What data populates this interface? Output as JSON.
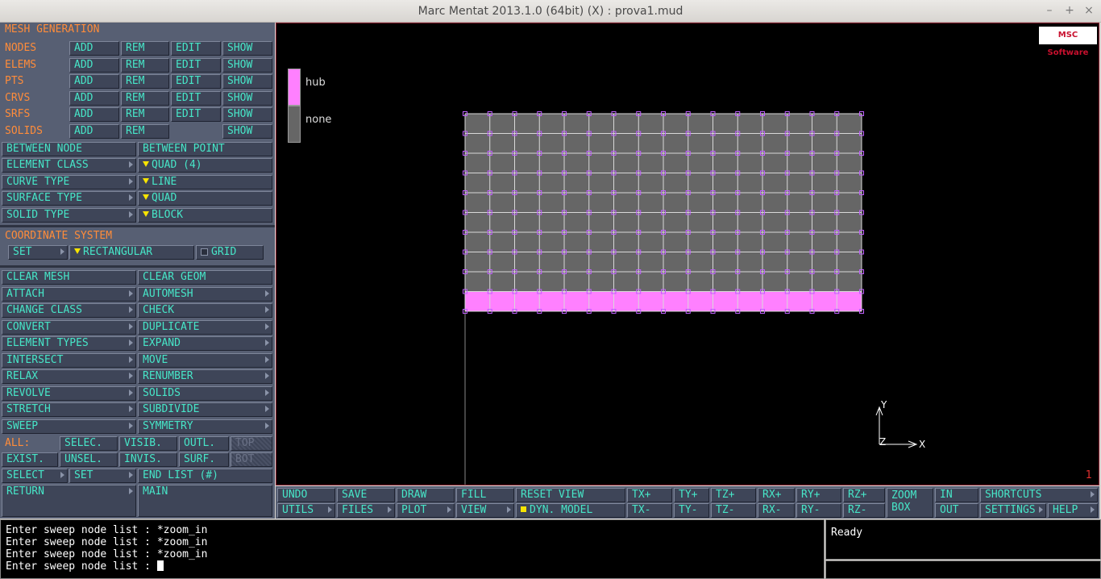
{
  "window": {
    "title": "Marc Mentat 2013.1.0 (64bit) (X) : prova1.mud",
    "controls": [
      "–",
      "+",
      "×"
    ]
  },
  "left_panel": {
    "header": "MESH GENERATION",
    "entity_rows": [
      {
        "label": "NODES",
        "buttons": [
          "ADD",
          "REM",
          "EDIT",
          "SHOW"
        ]
      },
      {
        "label": "ELEMS",
        "buttons": [
          "ADD",
          "REM",
          "EDIT",
          "SHOW"
        ]
      },
      {
        "label": "PTS",
        "buttons": [
          "ADD",
          "REM",
          "EDIT",
          "SHOW"
        ]
      },
      {
        "label": "CRVS",
        "buttons": [
          "ADD",
          "REM",
          "EDIT",
          "SHOW"
        ]
      },
      {
        "label": "SRFS",
        "buttons": [
          "ADD",
          "REM",
          "EDIT",
          "SHOW"
        ]
      },
      {
        "label": "SOLIDS",
        "buttons": [
          "ADD",
          "REM",
          "",
          "SHOW"
        ]
      }
    ],
    "between_node": "BETWEEN NODE",
    "between_point": "BETWEEN POINT",
    "type_rows": [
      {
        "label": "ELEMENT CLASS",
        "value": "QUAD (4)"
      },
      {
        "label": "CURVE TYPE",
        "value": "LINE"
      },
      {
        "label": "SURFACE TYPE",
        "value": "QUAD"
      },
      {
        "label": "SOLID TYPE",
        "value": "BLOCK"
      }
    ],
    "coord_header": "COORDINATE SYSTEM",
    "coord_set": "SET",
    "coord_value": "RECTANGULAR",
    "coord_grid": "GRID",
    "ops": [
      [
        "CLEAR MESH",
        "CLEAR GEOM"
      ],
      [
        "ATTACH",
        "AUTOMESH"
      ],
      [
        "CHANGE CLASS",
        "CHECK"
      ],
      [
        "CONVERT",
        "DUPLICATE"
      ],
      [
        "ELEMENT TYPES",
        "EXPAND"
      ],
      [
        "INTERSECT",
        "MOVE"
      ],
      [
        "RELAX",
        "RENUMBER"
      ],
      [
        "REVOLVE",
        "SOLIDS"
      ],
      [
        "STRETCH",
        "SUBDIVIDE"
      ],
      [
        "SWEEP",
        "SYMMETRY"
      ]
    ],
    "all_label": "ALL:",
    "sel_row1": [
      "SELEC.",
      "VISIB.",
      "OUTL.",
      "TOP"
    ],
    "sel_row2": [
      "EXIST.",
      "UNSEL.",
      "INVIS.",
      "SURF.",
      "BOT"
    ],
    "select": "SELECT",
    "set": "SET",
    "end_list": "END LIST (#)",
    "return": "RETURN",
    "main": "MAIN"
  },
  "viewport": {
    "logo": "MSC Software",
    "legend": [
      {
        "label": "hub",
        "color": "#ff80ff"
      },
      {
        "label": "none",
        "color": "#666666"
      }
    ],
    "axis_x": "X",
    "axis_y": "Y",
    "axis_z": "Z",
    "page_number": "1",
    "mesh": {
      "columns": 16,
      "rows": 10,
      "highlighted_rows": 1,
      "element_color": "#666666",
      "highlight_color": "#ff80ff",
      "node_color": "#c060ff"
    }
  },
  "toolbar": {
    "undo": "UNDO",
    "save": "SAVE",
    "draw": "DRAW",
    "fill": "FILL",
    "reset_view": "RESET VIEW",
    "utils": "UTILS",
    "files": "FILES",
    "plot": "PLOT",
    "view": "VIEW",
    "dyn_model": "DYN. MODEL",
    "tx_plus": "TX+",
    "ty_plus": "TY+",
    "tz_plus": "TZ+",
    "rx_plus": "RX+",
    "ry_plus": "RY+",
    "rz_plus": "RZ+",
    "tx_minus": "TX-",
    "ty_minus": "TY-",
    "tz_minus": "TZ-",
    "rx_minus": "RX-",
    "ry_minus": "RY-",
    "rz_minus": "RZ-",
    "zoom": "ZOOM",
    "box": "BOX",
    "in": "IN",
    "out": "OUT",
    "shortcuts": "SHORTCUTS",
    "settings": "SETTINGS",
    "help": "HELP"
  },
  "console": {
    "lines": [
      "Enter sweep node list : *zoom_in",
      "Enter sweep node list : *zoom_in",
      "Enter sweep node list : *zoom_in"
    ],
    "prompt": "Enter sweep node list : "
  },
  "status": {
    "text": "Ready"
  }
}
